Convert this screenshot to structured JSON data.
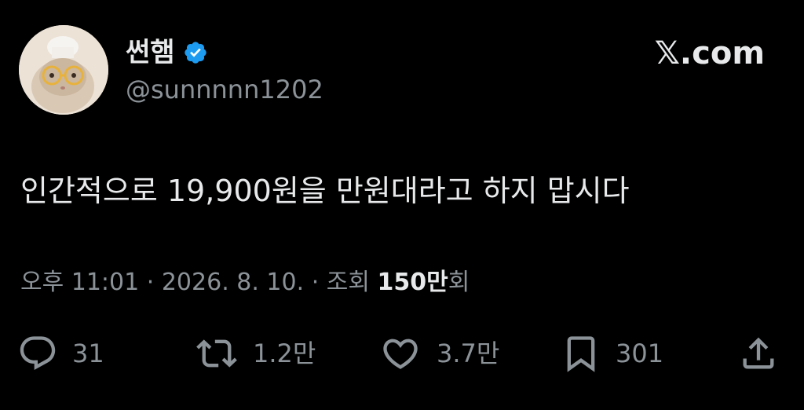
{
  "author": {
    "display_name": "썬햄",
    "handle": "@sunnnnn1202",
    "verified_icon": "verified-badge-icon",
    "verified_color": "#1d9bf0"
  },
  "brand": {
    "label": "𝕏.com"
  },
  "tweet": {
    "text": "인간적으로 19,900원을 만원대라고 하지 맙시다"
  },
  "meta": {
    "time": "오후 11:01",
    "separator_1": "·",
    "date": "2026. 8. 10.",
    "separator_2": "·",
    "views_prefix": "조회",
    "views_count": "150만",
    "views_suffix": "회"
  },
  "actions": {
    "reply": {
      "icon": "reply-icon",
      "count": "31"
    },
    "retweet": {
      "icon": "retweet-icon",
      "count": "1.2만"
    },
    "like": {
      "icon": "heart-icon",
      "count": "3.7만"
    },
    "bookmark": {
      "icon": "bookmark-icon",
      "count": "301"
    },
    "share": {
      "icon": "share-icon"
    }
  },
  "colors": {
    "background": "#000000",
    "primary_text": "#e7e9ea",
    "secondary_text": "#8b9298"
  }
}
